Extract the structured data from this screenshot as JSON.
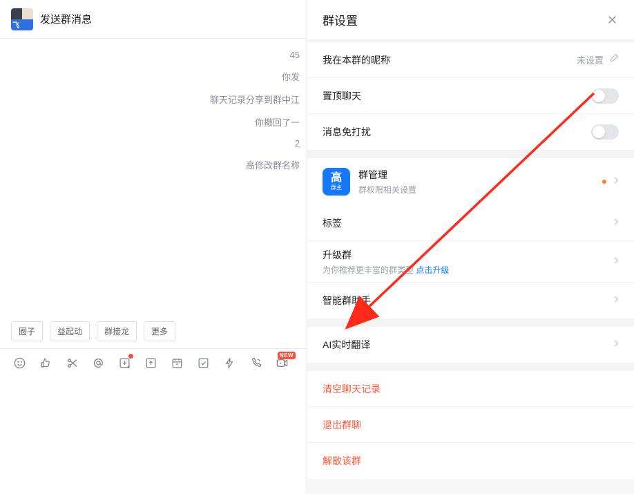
{
  "chat": {
    "title": "发送群消息",
    "log": [
      "45",
      "你发",
      "聊天记录分享到群中江",
      "你撤回了一",
      "2",
      "高修改群名称"
    ],
    "quick_buttons": [
      "圈子",
      "益起动",
      "群接龙",
      "更多"
    ],
    "new_badge": "NEW"
  },
  "settings": {
    "title": "群设置",
    "nickname": {
      "label": "我在本群的昵称",
      "value": "未设置"
    },
    "pin_chat": {
      "label": "置顶聊天"
    },
    "mute": {
      "label": "消息免打扰"
    },
    "management": {
      "icon_top": "高",
      "icon_bottom": "群主",
      "title": "群管理",
      "subtitle": "群权限相关设置"
    },
    "tags": {
      "label": "标签"
    },
    "upgrade": {
      "label": "升级群",
      "subtitle_prefix": "为你推荐更丰富的群类型 ",
      "subtitle_link": "点击升级"
    },
    "assistant": {
      "label": "智能群助手"
    },
    "ai_translate": {
      "label": "AI实时翻译"
    },
    "danger": {
      "clear": "清空聊天记录",
      "leave": "退出群聊",
      "disband": "解散该群"
    }
  }
}
